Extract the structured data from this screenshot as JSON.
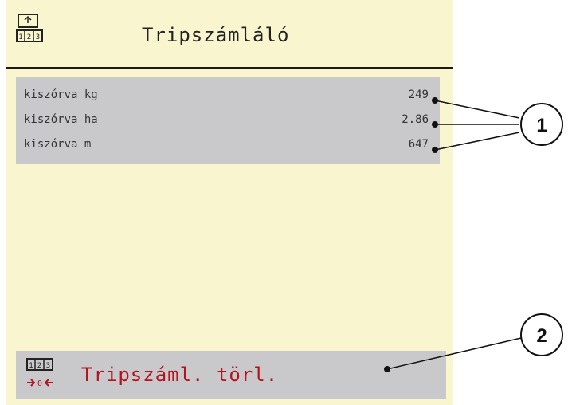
{
  "header": {
    "title": "Tripszámláló",
    "icon": "trip-counter-icon"
  },
  "rows": [
    {
      "label": "kiszórva kg",
      "value": "249"
    },
    {
      "label": "kiszórva ha",
      "value": "2.86"
    },
    {
      "label": "kiszórva m",
      "value": "647"
    }
  ],
  "reset": {
    "label": "Tripszáml. törl.",
    "icon": "reset-counter-icon",
    "color": "#b3121e"
  },
  "callouts": {
    "one": "1",
    "two": "2"
  },
  "colors": {
    "screen_bg": "#f8f5cf",
    "panel_bg": "#c9c9cc"
  }
}
